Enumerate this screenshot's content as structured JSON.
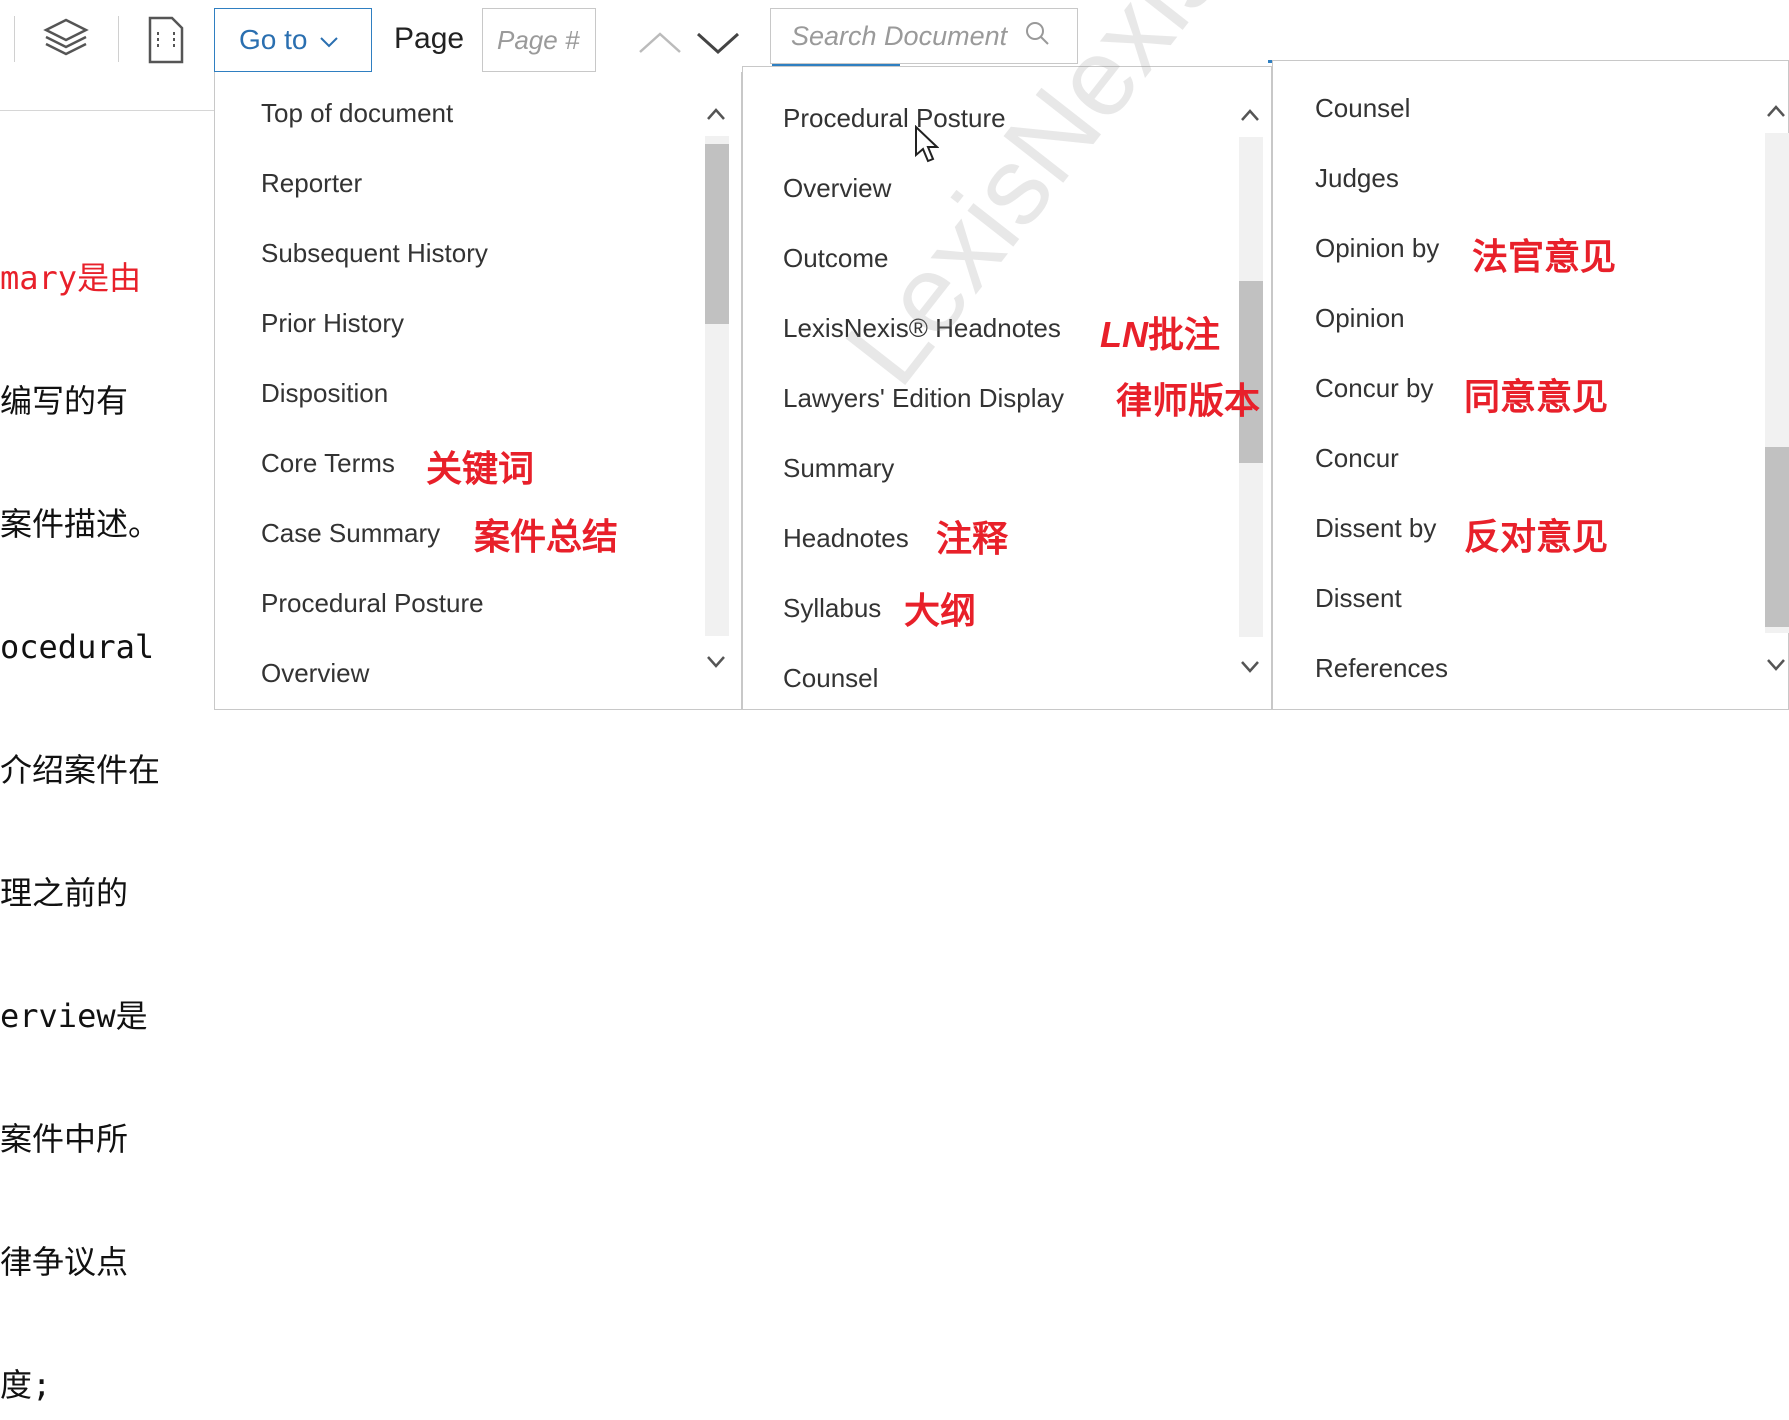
{
  "toolbar": {
    "goto_label": "Go to",
    "page_label": "Page",
    "page_placeholder": "Page #",
    "search_placeholder": "Search Document"
  },
  "left_note": {
    "lines": [
      "mary是由",
      "编写的有",
      "案件描述。",
      "ocedural",
      "介绍案件在",
      "理之前的",
      "erview是",
      "案件中所",
      "律争议点",
      "度;"
    ]
  },
  "menu1": {
    "items": [
      "Top of document",
      "Reporter",
      "Subsequent History",
      "Prior History",
      "Disposition",
      "Core Terms",
      "Case Summary",
      "Procedural Posture",
      "Overview"
    ]
  },
  "menu2": {
    "items": [
      "Procedural Posture",
      "Overview",
      "Outcome",
      "LexisNexis® Headnotes",
      "Lawyers' Edition Display",
      "Summary",
      "Headnotes",
      "Syllabus",
      "Counsel"
    ]
  },
  "menu3": {
    "items": [
      "Counsel",
      "Judges",
      "Opinion by",
      "Opinion",
      "Concur by",
      "Concur",
      "Dissent by",
      "Dissent",
      "References"
    ]
  },
  "annotations": {
    "core_terms": "关键词",
    "case_summary": "案件总结",
    "ln_prefix": "LN",
    "ln_suffix": "批注",
    "lawyers_edition": "律师版本",
    "headnotes": "注释",
    "syllabus": "大纲",
    "opinion_by": "法官意见",
    "concur_by": "同意意见",
    "dissent_by": "反对意见"
  },
  "watermark": "LexisNexis",
  "colors": {
    "accent": "#2f7fc1",
    "annotation": "#e8202a",
    "border": "#c8c8c8"
  }
}
